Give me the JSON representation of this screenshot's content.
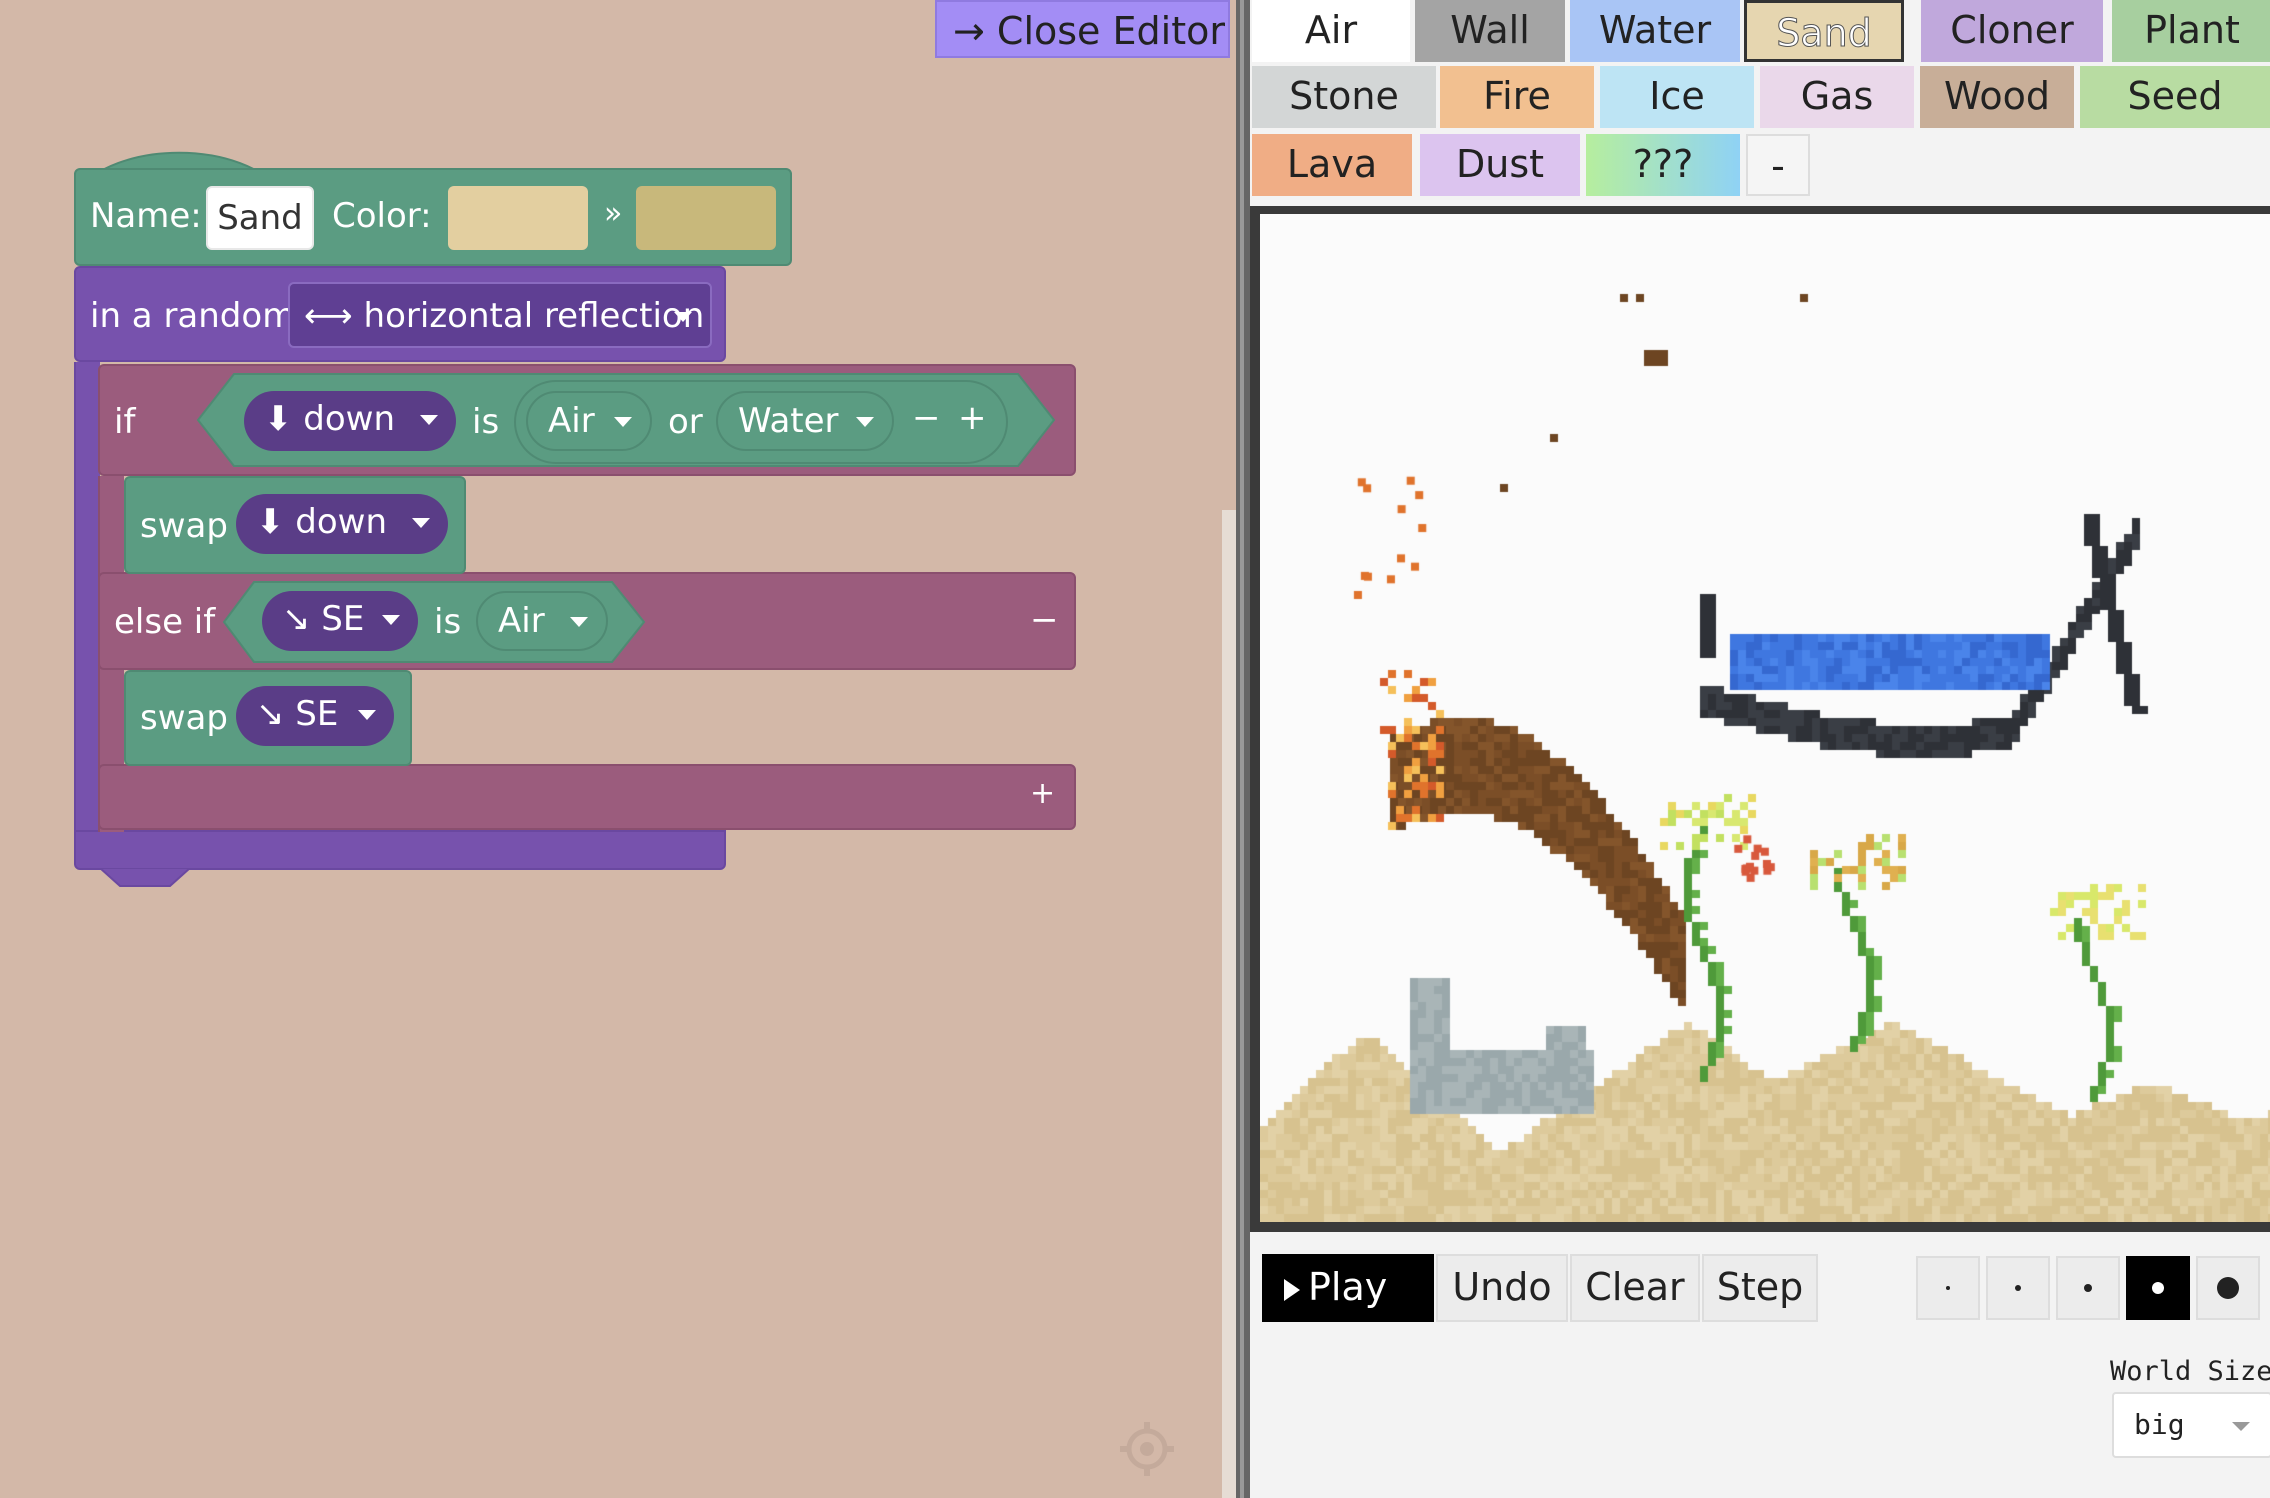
{
  "editor": {
    "close_label": "→ Close Editor",
    "element_block": {
      "name_label": "Name:",
      "name_value": "Sand",
      "color_label": "Color:",
      "color_sep": "»",
      "color_start": "#e3cfa0",
      "color_end": "#c8b87b"
    },
    "random_block": {
      "label": "in a random",
      "option": "⟷ horizontal reflection"
    },
    "if_block": {
      "label": "if",
      "dir": "⬇ down",
      "is": "is",
      "elem1": "Air",
      "or": "or",
      "elem2": "Water",
      "minus": "−",
      "plus": "+"
    },
    "swap1": {
      "label": "swap",
      "dir": "⬇ down"
    },
    "elseif_block": {
      "label": "else if",
      "dir": "↘ SE",
      "is": "is",
      "elem": "Air",
      "minus": "−"
    },
    "swap2": {
      "label": "swap",
      "dir": "↘ SE"
    },
    "add": "+"
  },
  "palette": {
    "row1": [
      {
        "label": "Air",
        "color": "#ffffff"
      },
      {
        "label": "Wall",
        "color": "#a4a4a4"
      },
      {
        "label": "Water",
        "color": "#a9c5f5"
      },
      {
        "label": "Sand",
        "color": "#e6d6b0"
      },
      {
        "label": "Cloner",
        "color": "#c0a8dc"
      },
      {
        "label": "Plant",
        "color": "#a7cf9f"
      }
    ],
    "row2": [
      {
        "label": "Stone",
        "color": "#d3d6d6"
      },
      {
        "label": "Fire",
        "color": "#f2c090"
      },
      {
        "label": "Ice",
        "color": "#bde4f4"
      },
      {
        "label": "Gas",
        "color": "#ead8ea"
      },
      {
        "label": "Wood",
        "color": "#c8ae98"
      },
      {
        "label": "Seed",
        "color": "#b8dca2"
      }
    ],
    "row3": [
      {
        "label": "Lava",
        "color": "#f0ad85"
      },
      {
        "label": "Dust",
        "color": "#dcc4ef"
      },
      {
        "label": "???",
        "color": "#a8e2c4"
      },
      {
        "label": "-",
        "color": "#f5f5f5"
      }
    ],
    "selected": "Sand"
  },
  "controls": {
    "play": "Play",
    "undo": "Undo",
    "clear": "Clear",
    "step": "Step"
  },
  "brush_sizes": [
    "1",
    "2",
    "3",
    "4",
    "5"
  ],
  "brush_selected": "4",
  "world": {
    "label": "World Size",
    "value": "big"
  }
}
